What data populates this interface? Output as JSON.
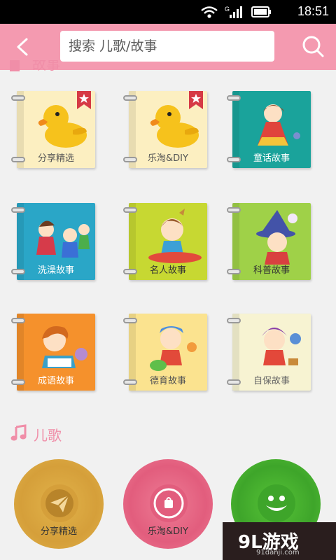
{
  "status_bar": {
    "time": "18:51",
    "network_label": "G"
  },
  "header": {
    "search_placeholder": "搜索 儿歌/故事"
  },
  "stories": {
    "section_title": "故事",
    "books": [
      {
        "label": "分享精选",
        "color": "#fcefc1",
        "label_color": "#555555",
        "art": "duck",
        "ribbon": true
      },
      {
        "label": "乐淘&DIY",
        "color": "#fcefc1",
        "label_color": "#555555",
        "art": "duck",
        "ribbon": true
      },
      {
        "label": "童话故事",
        "color": "#1aa39b",
        "label_color": "#ffffff",
        "art": "girl",
        "ribbon": false
      },
      {
        "label": "洗澡故事",
        "color": "#2aa6c7",
        "label_color": "#ffffff",
        "art": "kids",
        "ribbon": false
      },
      {
        "label": "名人故事",
        "color": "#c7d832",
        "label_color": "#333333",
        "art": "boy",
        "ribbon": false
      },
      {
        "label": "科普故事",
        "color": "#9fd148",
        "label_color": "#333333",
        "art": "wizard",
        "ribbon": false
      },
      {
        "label": "成语故事",
        "color": "#f5912c",
        "label_color": "#ffffff",
        "art": "reader",
        "ribbon": false
      },
      {
        "label": "德育故事",
        "color": "#fbe38f",
        "label_color": "#555555",
        "art": "kid",
        "ribbon": false
      },
      {
        "label": "自保故事",
        "color": "#f7f3d2",
        "label_color": "#666666",
        "art": "crying",
        "ribbon": false
      }
    ]
  },
  "songs": {
    "section_title": "儿歌",
    "discs": [
      {
        "label": "分享精选",
        "color": "#e2b34a",
        "inner": "#d59f3a",
        "icon": "paper-plane-icon"
      },
      {
        "label": "乐淘&DIY",
        "color": "#ee7c95",
        "inner": "#e25d7d",
        "icon": "shopping-bag-icon"
      },
      {
        "label": "",
        "color": "#57c337",
        "inner": "#3ea52a",
        "icon": "clown-icon"
      }
    ]
  },
  "watermark": {
    "main": "9L游戏",
    "sub": "91danji.com"
  },
  "colors": {
    "accent": "#f49ab0",
    "section_title": "#f08ea8"
  }
}
